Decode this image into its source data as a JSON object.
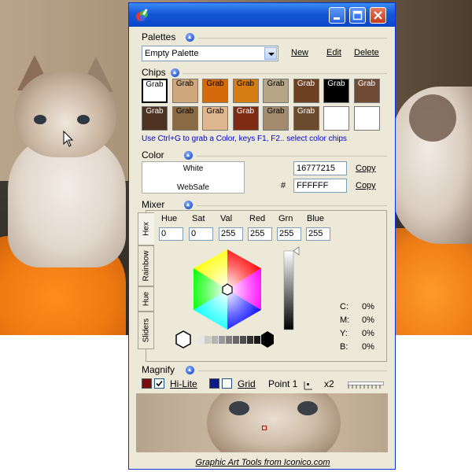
{
  "window": {
    "title": ""
  },
  "palettes": {
    "label": "Palettes",
    "selected": "Empty Palette",
    "new_label": "New",
    "edit_label": "Edit",
    "delete_label": "Delete"
  },
  "chips": {
    "label": "Chips",
    "grab_label": "Grab",
    "row1_colors": [
      "#ffffff",
      "#cfa77c",
      "#d46a0a",
      "#d57d12",
      "#b7a685",
      "#6c4023",
      "#000000",
      "#704b33"
    ],
    "row2_colors": [
      "#4e3221",
      "#8a6b44",
      "#dfb78e",
      "#7d2a11",
      "#a48b6d",
      "#6b4b2e",
      "#ffffff",
      "#ffffff"
    ],
    "hint": "Use Ctrl+G to grab a Color, keys F1, F2.. select color chips"
  },
  "color": {
    "label": "Color",
    "name": "White",
    "websafe": "WebSafe",
    "decimal": "16777215",
    "hex_prefix": "#",
    "hex": "FFFFFF",
    "copy_label": "Copy"
  },
  "mixer": {
    "label": "Mixer",
    "tabs": [
      "Hex",
      "Rainbow",
      "Hue",
      "Sliders"
    ],
    "hue_label": "Hue",
    "sat_label": "Sat",
    "val_label": "Val",
    "red_label": "Red",
    "grn_label": "Grn",
    "blue_label": "Blue",
    "hue": "0",
    "sat": "0",
    "val": "255",
    "red": "255",
    "grn": "255",
    "blue": "255",
    "cmyk": {
      "c_label": "C:",
      "c": "0%",
      "m_label": "M:",
      "m": "0%",
      "y_label": "Y:",
      "y": "0%",
      "b_label": "B:",
      "b": "0%"
    }
  },
  "magnify": {
    "label": "Magnify",
    "hilite_label": "Hi-Lite",
    "grid_label": "Grid",
    "point_label": "Point 1",
    "zoom_label": "x2",
    "hilite_color": "#7a0d0d",
    "grid_color": "#0a1a8a"
  },
  "footer": {
    "text": "Graphic Art Tools from Iconico.com"
  }
}
